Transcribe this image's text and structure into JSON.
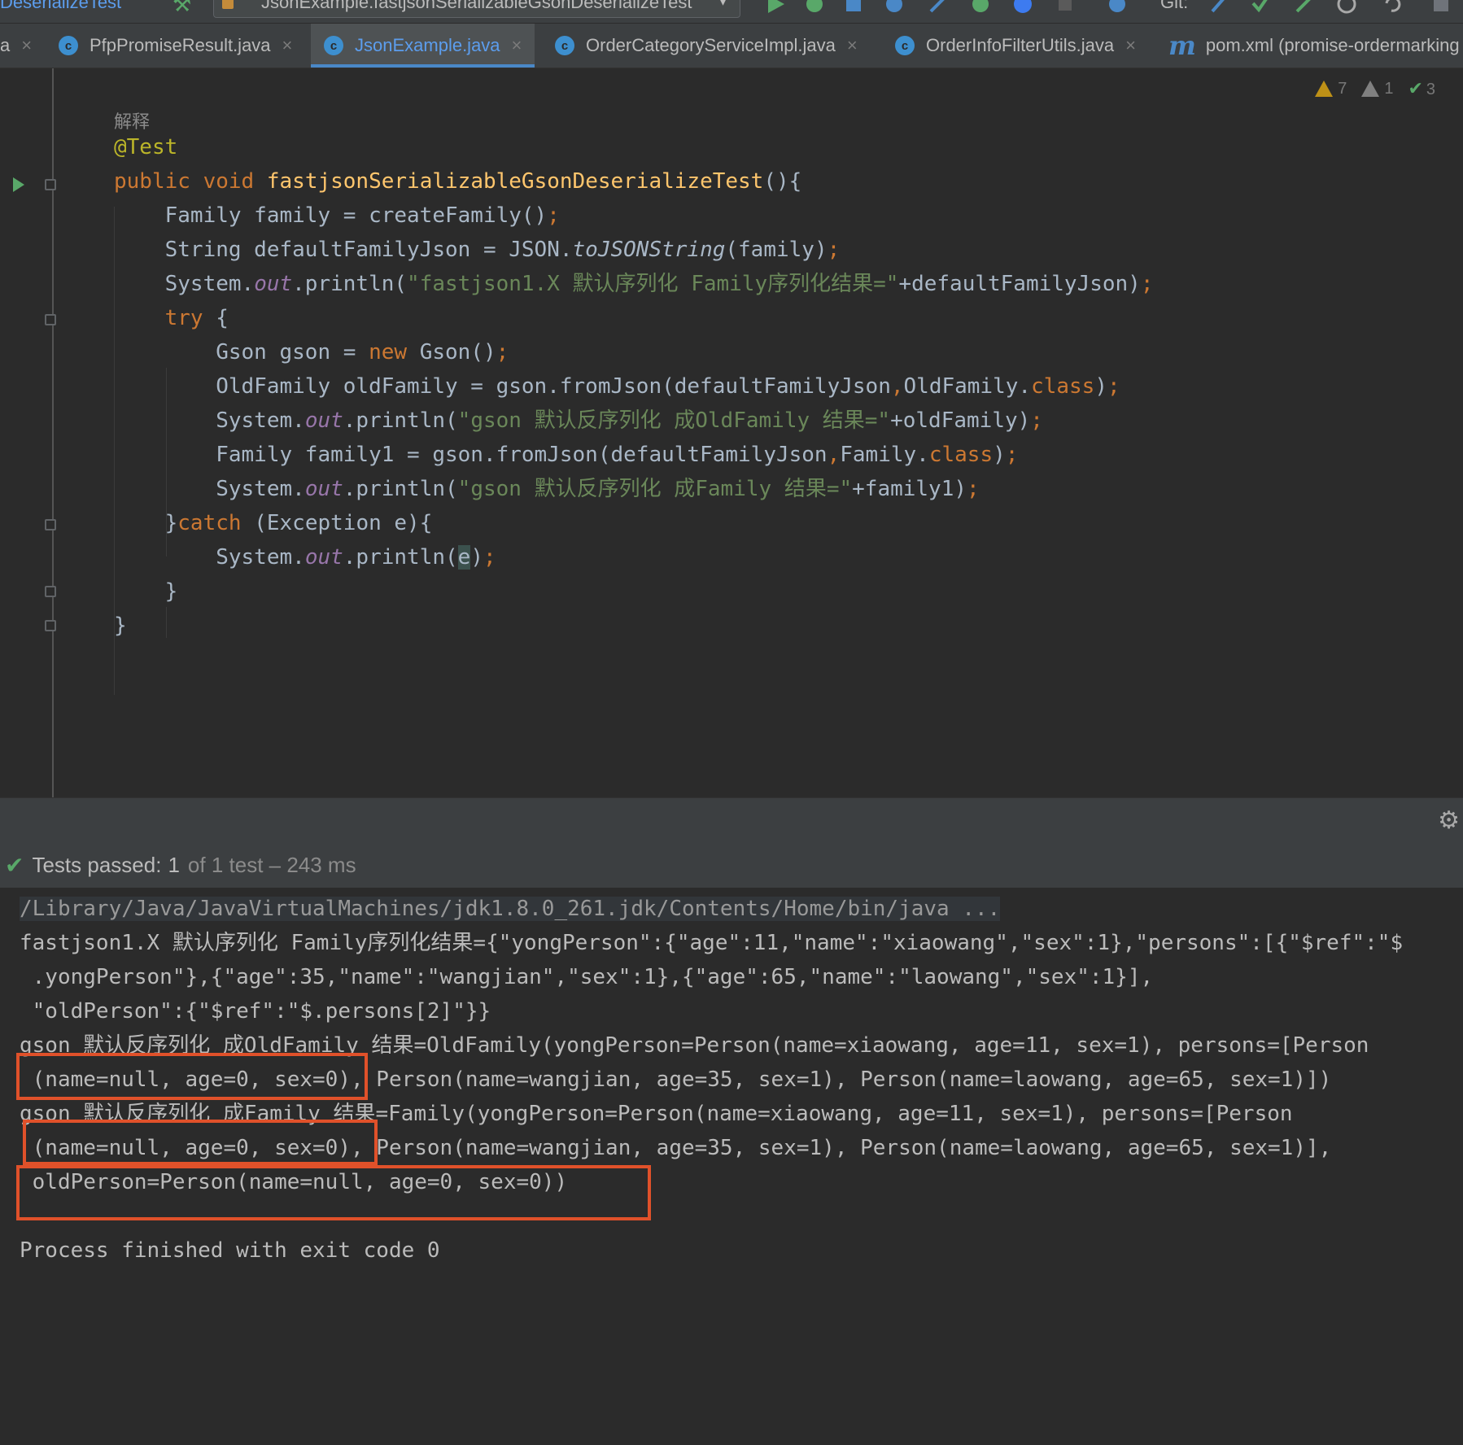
{
  "toolbar": {
    "breadcrumb": "DeserializeTest",
    "run_config": "JsonExample.fastjsonSerializableGsonDeserializeTest",
    "git_label": "Git:"
  },
  "tabs": [
    {
      "label": "a",
      "icon": "class-icon",
      "active": false
    },
    {
      "label": "PfpPromiseResult.java",
      "icon": "class-icon",
      "active": false
    },
    {
      "label": "JsonExample.java",
      "icon": "class-icon",
      "active": true
    },
    {
      "label": "OrderCategoryServiceImpl.java",
      "icon": "class-icon",
      "active": false
    },
    {
      "label": "OrderInfoFilterUtils.java",
      "icon": "class-icon",
      "active": false
    },
    {
      "label": "pom.xml (promise-ordermarking",
      "icon": "maven-icon",
      "active": false
    }
  ],
  "inspections": {
    "warnings": "7",
    "weak_warnings": "1",
    "typos": "3"
  },
  "editor": {
    "inlay_hint": "解释",
    "lines": [
      "@Test",
      "public void fastjsonSerializableGsonDeserializeTest(){",
      "    Family family = createFamily();",
      "    String defaultFamilyJson = JSON.toJSONString(family);",
      "    System.out.println(\"fastjson1.X 默认序列化 Family序列化结果=\"+defaultFamilyJson);",
      "    try {",
      "        Gson gson = new Gson();",
      "        OldFamily oldFamily = gson.fromJson(defaultFamilyJson,OldFamily.class);",
      "        System.out.println(\"gson 默认反序列化 成OldFamily 结果=\"+oldFamily);",
      "        Family family1 = gson.fromJson(defaultFamilyJson,Family.class);",
      "        System.out.println(\"gson 默认反序列化 成Family 结果=\"+family1);",
      "    }catch (Exception e){",
      "        System.out.println(e);",
      "    }",
      "}"
    ]
  },
  "test_status": {
    "label": "Tests passed:",
    "passed": "1",
    "rest": "of 1 test – 243 ms"
  },
  "console": {
    "command": "/Library/Java/JavaVirtualMachines/jdk1.8.0_261.jdk/Contents/Home/bin/java ...",
    "lines": [
      "fastjson1.X 默认序列化 Family序列化结果={\"yongPerson\":{\"age\":11,\"name\":\"xiaowang\",\"sex\":1},\"persons\":[{\"$ref\":\"$",
      " .yongPerson\"},{\"age\":35,\"name\":\"wangjian\",\"sex\":1},{\"age\":65,\"name\":\"laowang\",\"sex\":1}],",
      " \"oldPerson\":{\"$ref\":\"$.persons[2]\"}}",
      "gson 默认反序列化 成OldFamily 结果=OldFamily(yongPerson=Person(name=xiaowang, age=11, sex=1), persons=[Person",
      " (name=null, age=0, sex=0), Person(name=wangjian, age=35, sex=1), Person(name=laowang, age=65, sex=1)])",
      "gson 默认反序列化 成Family 结果=Family(yongPerson=Person(name=xiaowang, age=11, sex=1), persons=[Person",
      " (name=null, age=0, sex=0), Person(name=wangjian, age=35, sex=1), Person(name=laowang, age=65, sex=1)],",
      " oldPerson=Person(name=null, age=0, sex=0))",
      "",
      "Process finished with exit code 0"
    ]
  },
  "colors": {
    "highlight_box": "#e0512a",
    "keyword": "#cc7832",
    "string": "#6a8759",
    "method": "#ffc66d",
    "annotation": "#bbb529",
    "field": "#9876aa",
    "pass_green": "#59a869"
  }
}
